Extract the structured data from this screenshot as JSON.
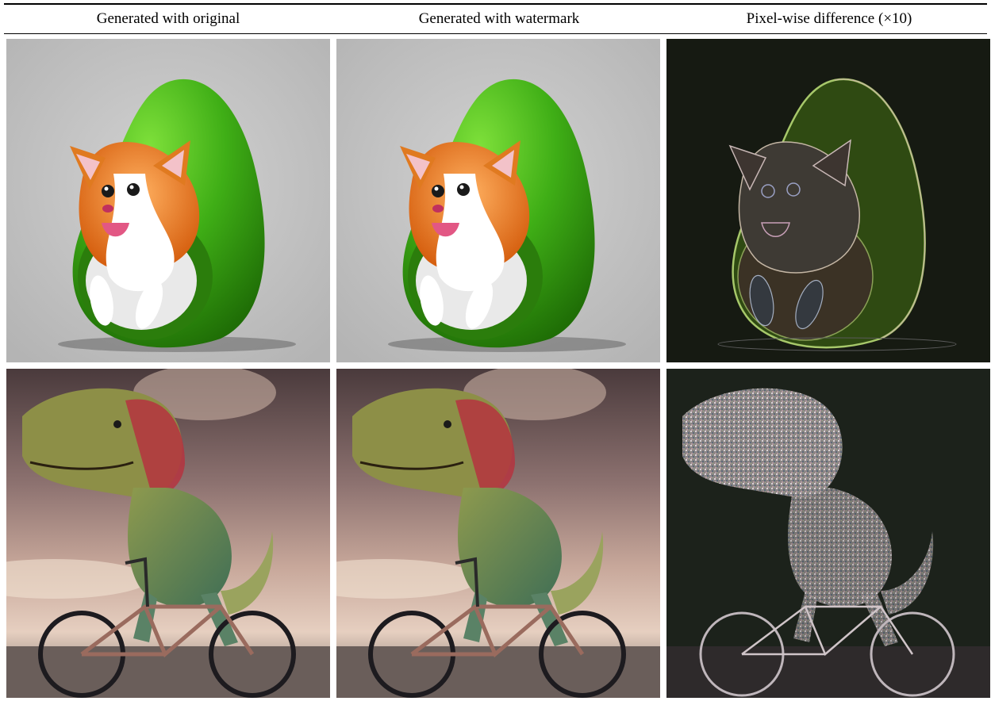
{
  "table": {
    "headers": [
      "Generated with original",
      "Generated with watermark",
      "Pixel-wise difference (×10)"
    ]
  },
  "rows": [
    {
      "subject": "corgi in avocado",
      "images": [
        "corgi-avocado-original",
        "corgi-avocado-watermark",
        "corgi-avocado-difference"
      ]
    },
    {
      "subject": "t-rex riding bicycle",
      "images": [
        "trex-bicycle-original",
        "trex-bicycle-watermark",
        "trex-bicycle-difference"
      ]
    }
  ]
}
